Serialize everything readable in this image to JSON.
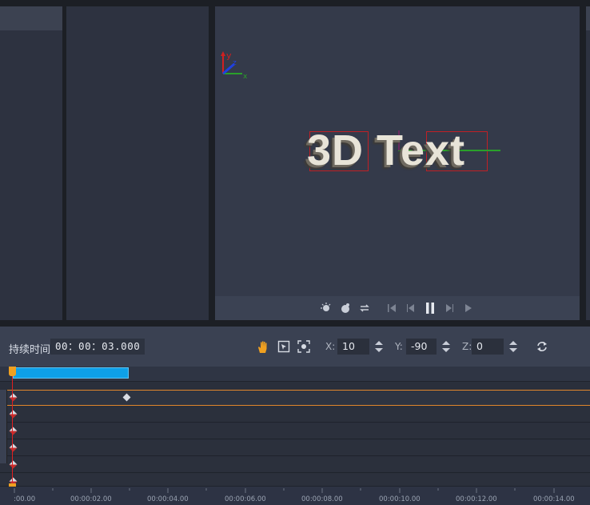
{
  "viewport": {
    "text": "3D Text",
    "gizmo_axes": {
      "x": "x",
      "y": "y",
      "z": "z"
    },
    "colors": {
      "text": "#e8e4d8",
      "selection": "#c02025",
      "axis_x": "#2aa02a",
      "axis_y": "#d02020",
      "axis_z": "#2040e0"
    }
  },
  "playbar": {
    "buttons": [
      "light-icon",
      "material-icon",
      "loop-icon",
      "skip-start-icon",
      "prev-frame-icon",
      "pause-icon",
      "next-frame-icon",
      "play-icon"
    ]
  },
  "properties": {
    "duration_label": "持续时间",
    "duration_value": "00：00：03.000",
    "tools": [
      "hand-tool-icon",
      "move-tool-icon",
      "scale-tool-icon"
    ],
    "x_label": "X:",
    "x_value": "10",
    "y_label": "Y:",
    "y_value": "-90",
    "z_label": "Z:",
    "z_value": "0",
    "reset_icon": "refresh-icon"
  },
  "timeline": {
    "clip_color": "#0ea0e8",
    "playhead_color": "#f0a020",
    "ruler_labels": [
      ":00.00",
      "00:00:02.00",
      "00:00:04.00",
      "00:00:06.00",
      "00:00:08.00",
      "00:00:10.00",
      "00:00:12.00",
      "00:00:14.00"
    ]
  }
}
